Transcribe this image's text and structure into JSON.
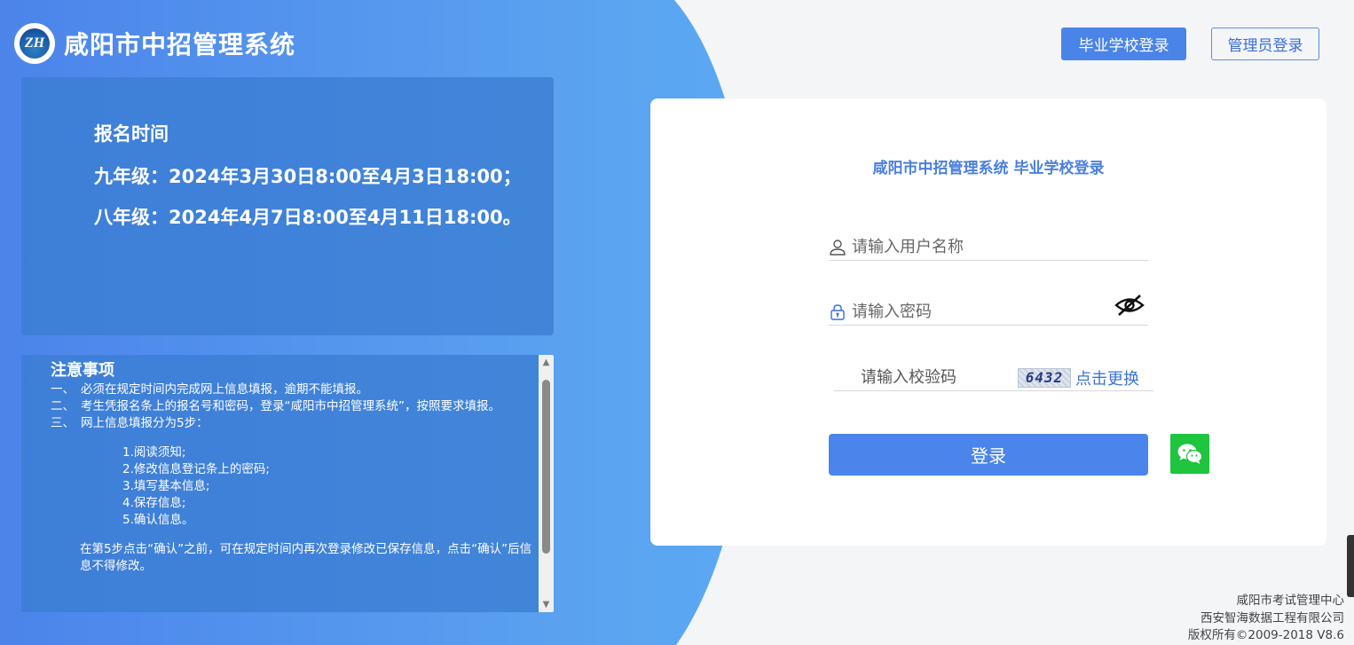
{
  "header": {
    "logo_text": "ZH",
    "title": "咸阳市中招管理系统",
    "school_login_label": "毕业学校登录",
    "admin_login_label": "管理员登录"
  },
  "registration": {
    "heading": "报名时间",
    "grade9": "九年级：2024年3月30日8:00至4月3日18:00；",
    "grade8": "八年级：2024年4月7日8:00至4月11日18:00。"
  },
  "notice": {
    "title": "注意事项",
    "items": [
      {
        "num": "一、",
        "text": "必须在规定时间内完成网上信息填报，逾期不能填报。"
      },
      {
        "num": "二、",
        "text": "考生凭报名条上的报名号和密码，登录“咸阳市中招管理系统”，按照要求填报。"
      },
      {
        "num": "三、",
        "text": "网上信息填报分为5步："
      }
    ],
    "steps": [
      "1.阅读须知;",
      "2.修改信息登记条上的密码;",
      "3.填写基本信息;",
      "4.保存信息;",
      "5.确认信息。"
    ],
    "final": "在第5步点击“确认”之前，可在规定时间内再次登录修改已保存信息，点击“确认”后信息不得修改。"
  },
  "login": {
    "title": "咸阳市中招管理系统 毕业学校登录",
    "username_placeholder": "请输入用户名称",
    "password_placeholder": "请输入密码",
    "captcha_placeholder": "请输入校验码",
    "captcha_code": "6432",
    "refresh_label": "点击更换",
    "submit_label": "登录"
  },
  "footer": {
    "line1": "咸阳市考试管理中心",
    "line2": "西安智海数据工程有限公司",
    "line3": "版权所有©2009-2018 V8.6"
  },
  "colors": {
    "primary": "#4b84eb",
    "wechat": "#1fc43f",
    "title_blue": "#4a7fe0"
  }
}
